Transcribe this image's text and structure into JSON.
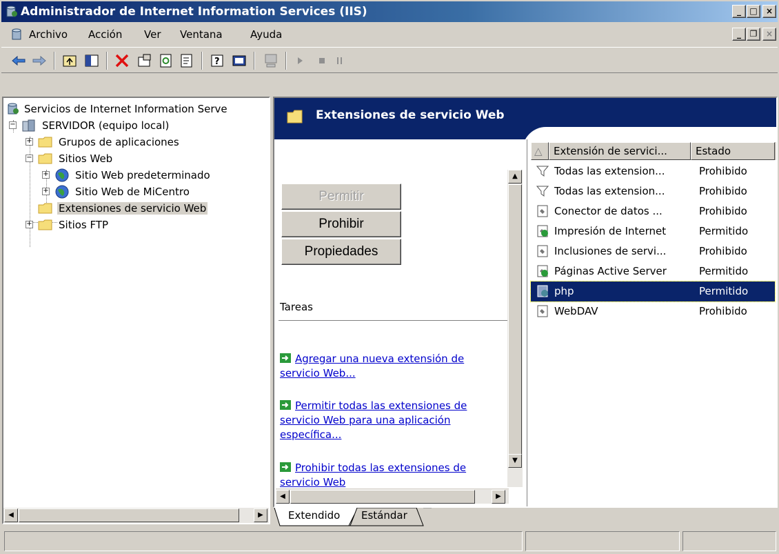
{
  "window": {
    "title": "Administrador de Internet Information Services (IIS)",
    "minimize_glyph": "_",
    "maximize_glyph": "□",
    "close_glyph": "×",
    "restore_glyph": "❐"
  },
  "menu": {
    "items": [
      "Archivo",
      "Acción",
      "Ver",
      "Ventana",
      "Ayuda"
    ]
  },
  "toolbar": {
    "icons": [
      "back-arrow-icon",
      "forward-arrow-icon",
      "up-folder-icon",
      "show-hide-tree-icon",
      "delete-icon",
      "properties-icon",
      "refresh-icon",
      "export-list-icon",
      "help-icon",
      "console-icon",
      "computer-icon",
      "play-icon",
      "stop-icon",
      "pause-icon"
    ]
  },
  "tree": {
    "items": [
      {
        "label": "Servicios de Internet Information Serve",
        "icon": "iis-icon"
      },
      {
        "label": "SERVIDOR (equipo local)",
        "icon": "server-icon"
      },
      {
        "label": "Grupos de aplicaciones",
        "icon": "folder-icon"
      },
      {
        "label": "Sitios Web",
        "icon": "folder-icon"
      },
      {
        "label": "Sitio Web predeterminado",
        "icon": "globe-icon"
      },
      {
        "label": "Sitio Web de MiCentro",
        "icon": "globe-icon"
      },
      {
        "label": "Extensiones de servicio Web",
        "icon": "folder-icon",
        "selected": true
      },
      {
        "label": "Sitios FTP",
        "icon": "folder-icon"
      }
    ]
  },
  "panel": {
    "title": "Extensiones de servicio Web",
    "buttons": {
      "allow": "Permitir",
      "deny": "Prohibir",
      "properties": "Propiedades"
    },
    "tasks_title": "Tareas",
    "tasks": [
      "Agregar una nueva extensión de servicio Web...",
      "Permitir todas las extensiones de servicio Web para una aplicación específica...",
      "Prohibir todas las extensiones de servicio Web"
    ]
  },
  "list": {
    "columns": [
      "Extensión de servici...",
      "Estado"
    ],
    "rows": [
      {
        "name": "Todas las extension...",
        "status": "Prohibido",
        "icon": "filter-icon"
      },
      {
        "name": "Todas las extension...",
        "status": "Prohibido",
        "icon": "filter-icon"
      },
      {
        "name": "Conector de datos ...",
        "status": "Prohibido",
        "icon": "extension-denied-icon"
      },
      {
        "name": "Impresión de Internet",
        "status": "Permitido",
        "icon": "extension-allowed-icon"
      },
      {
        "name": "Inclusiones de servi...",
        "status": "Prohibido",
        "icon": "extension-denied-icon"
      },
      {
        "name": "Páginas Active Server",
        "status": "Permitido",
        "icon": "extension-allowed-icon"
      },
      {
        "name": "php",
        "status": "Permitido",
        "icon": "extension-allowed-icon",
        "selected": true
      },
      {
        "name": "WebDAV",
        "status": "Prohibido",
        "icon": "extension-denied-icon"
      }
    ]
  },
  "tabs": [
    "Extendido",
    "Estándar"
  ],
  "colors": {
    "title_bar": "#0a246a",
    "face": "#d4d0c8",
    "link": "#0000cc",
    "selection": "#0a246a"
  }
}
